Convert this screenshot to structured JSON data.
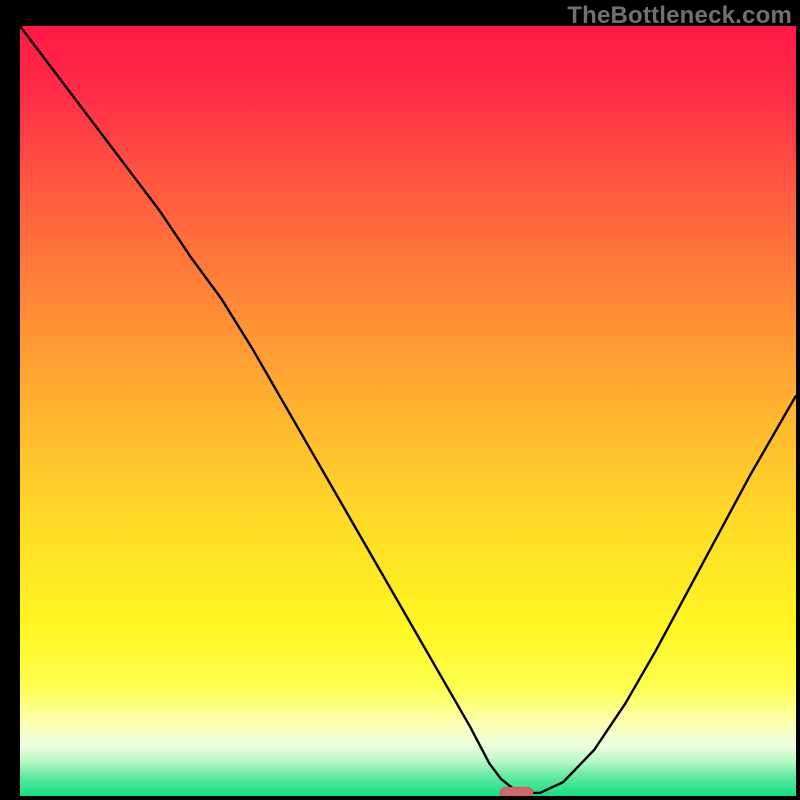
{
  "watermark": "TheBottleneck.com",
  "colors": {
    "frame": "#000000",
    "watermark": "#707070",
    "curve": "#000000",
    "marker_fill": "#d0676a",
    "marker_stroke": "#c65a5d",
    "gradient_stops": [
      {
        "offset": 0.0,
        "color": "#ff1846"
      },
      {
        "offset": 0.08,
        "color": "#ff2a46"
      },
      {
        "offset": 0.2,
        "color": "#ff5640"
      },
      {
        "offset": 0.35,
        "color": "#ff8538"
      },
      {
        "offset": 0.5,
        "color": "#ffb42f"
      },
      {
        "offset": 0.65,
        "color": "#ffdc27"
      },
      {
        "offset": 0.78,
        "color": "#fff622"
      },
      {
        "offset": 0.86,
        "color": "#fdff51"
      },
      {
        "offset": 0.905,
        "color": "#fbffb0"
      },
      {
        "offset": 0.935,
        "color": "#ecffdf"
      },
      {
        "offset": 0.955,
        "color": "#b8f7c6"
      },
      {
        "offset": 0.975,
        "color": "#62e9a0"
      },
      {
        "offset": 1.0,
        "color": "#12de85"
      }
    ]
  },
  "chart_data": {
    "type": "line",
    "title": "",
    "xlabel": "",
    "ylabel": "",
    "xlim": [
      0,
      100
    ],
    "ylim": [
      0,
      100
    ],
    "x": [
      0,
      6,
      12,
      18,
      22,
      26,
      30,
      34,
      38,
      42,
      46,
      50,
      54,
      58,
      60.5,
      62,
      63.5,
      65,
      67,
      70,
      74,
      78,
      82,
      86,
      90,
      94,
      100
    ],
    "values": [
      100,
      92,
      84,
      76,
      70,
      64.5,
      58,
      51,
      44,
      37,
      30,
      23,
      16,
      9,
      4.2,
      2.2,
      1.0,
      0.4,
      0.4,
      1.8,
      6,
      12,
      19,
      26.5,
      34,
      41.5,
      52
    ],
    "marker": {
      "x": 64,
      "y": 0.4,
      "w": 4.2,
      "h": 1.4
    }
  }
}
